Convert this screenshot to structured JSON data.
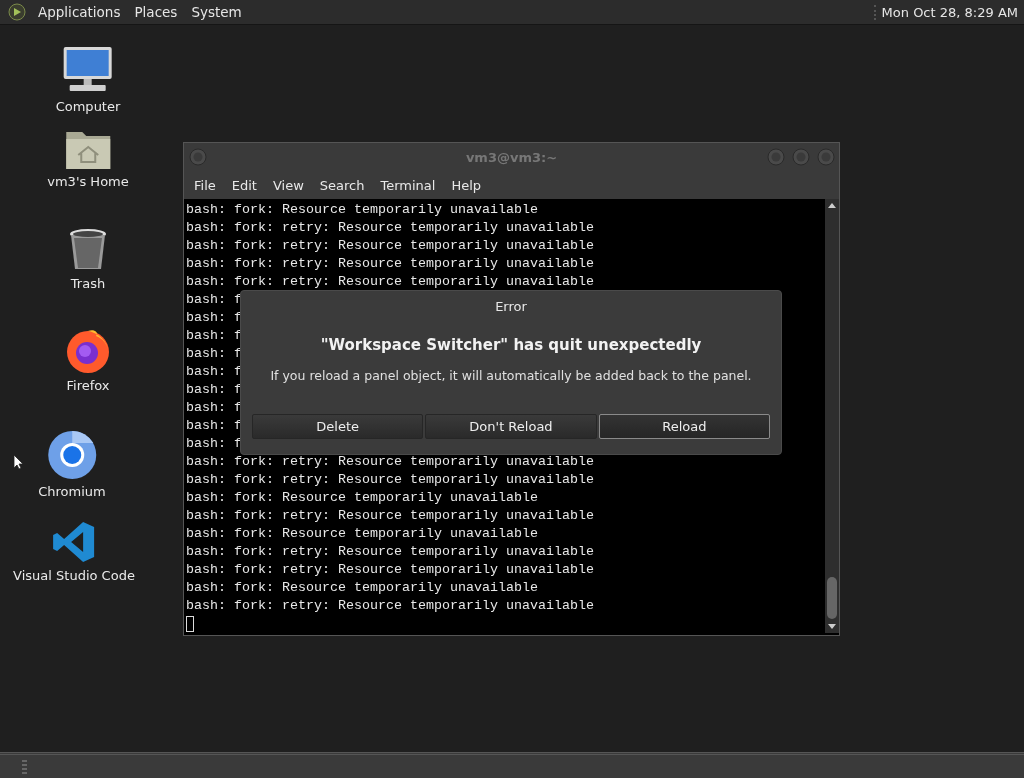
{
  "top_panel": {
    "menus": [
      "Applications",
      "Places",
      "System"
    ],
    "clock": "Mon Oct 28,  8:29 AM"
  },
  "desktop_icons": [
    {
      "label": "Computer",
      "kind": "computer"
    },
    {
      "label": "vm3's Home",
      "kind": "home"
    },
    {
      "label": "Trash",
      "kind": "trash"
    },
    {
      "label": "Firefox",
      "kind": "firefox"
    },
    {
      "label": "Chromium",
      "kind": "chromium"
    },
    {
      "label": "Visual Studio Code",
      "kind": "vscode"
    }
  ],
  "terminal": {
    "title": "vm3@vm3:~",
    "menu": [
      "File",
      "Edit",
      "View",
      "Search",
      "Terminal",
      "Help"
    ],
    "lines": [
      "bash: fork: Resource temporarily unavailable",
      "bash: fork: retry: Resource temporarily unavailable",
      "bash: fork: retry: Resource temporarily unavailable",
      "bash: fork: retry: Resource temporarily unavailable",
      "bash: fork: retry: Resource temporarily unavailable",
      "bash: f",
      "bash: f",
      "bash: f",
      "bash: f",
      "bash: f",
      "bash: f",
      "bash: f",
      "bash: f",
      "bash: f",
      "bash: fork: retry: Resource temporarily unavailable",
      "bash: fork: retry: Resource temporarily unavailable",
      "bash: fork: Resource temporarily unavailable",
      "bash: fork: retry: Resource temporarily unavailable",
      "bash: fork: Resource temporarily unavailable",
      "bash: fork: retry: Resource temporarily unavailable",
      "bash: fork: retry: Resource temporarily unavailable",
      "bash: fork: Resource temporarily unavailable",
      "bash: fork: retry: Resource temporarily unavailable"
    ]
  },
  "dialog": {
    "title": "Error",
    "heading": "\"Workspace Switcher\" has quit unexpectedly",
    "message": "If you reload a panel object, it will automatically be added back to the panel.",
    "buttons": [
      {
        "label": "Delete",
        "focused": false
      },
      {
        "label": "Don't Reload",
        "focused": false
      },
      {
        "label": "Reload",
        "focused": true
      }
    ]
  }
}
